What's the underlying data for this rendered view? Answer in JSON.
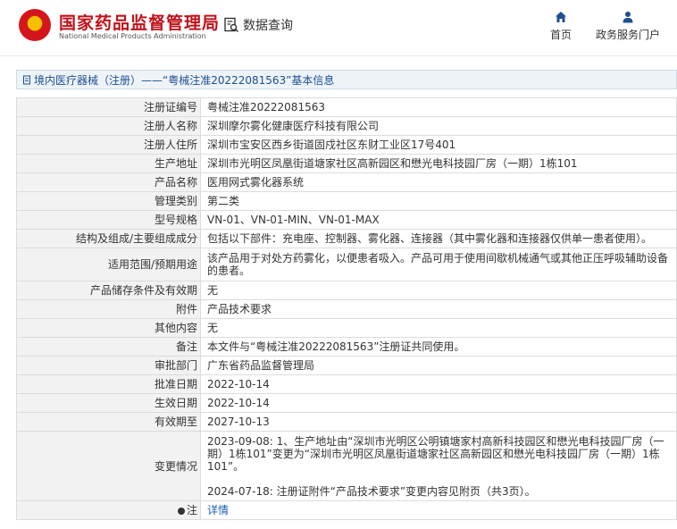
{
  "header": {
    "brand_cn": "国家药品监督管理局",
    "brand_en": "National Medical Products Administration",
    "query_label": "数据查询",
    "nav": [
      {
        "label": "首页",
        "icon": "home-icon"
      },
      {
        "label": "政务服务门户",
        "icon": "user-icon"
      }
    ]
  },
  "breadcrumb": "境内医疗器械（注册）——“粤械注准20222081563”基本信息",
  "rows": [
    {
      "label": "注册证编号",
      "value": "粤械注准20222081563"
    },
    {
      "label": "注册人名称",
      "value": "深圳摩尔雾化健康医疗科技有限公司"
    },
    {
      "label": "注册人住所",
      "value": "深圳市宝安区西乡街道固戍社区东财工业区17号401"
    },
    {
      "label": "生产地址",
      "value": "深圳市光明区凤凰街道塘家社区高新园区和懋光电科技园厂房（一期）1栋101"
    },
    {
      "label": "产品名称",
      "value": "医用网式雾化器系统"
    },
    {
      "label": "管理类别",
      "value": "第二类"
    },
    {
      "label": "型号规格",
      "value": "VN-01、VN-01-MIN、VN-01-MAX"
    },
    {
      "label": "结构及组成/主要组成成分",
      "value": "包括以下部件：充电座、控制器、雾化器、连接器（其中雾化器和连接器仅供单一患者使用）。"
    },
    {
      "label": "适用范围/预期用途",
      "value": "该产品用于对处方药雾化，以便患者吸入。产品可用于使用间歇机械通气或其他正压呼吸辅助设备的患者。"
    },
    {
      "label": "产品储存条件及有效期",
      "value": "无"
    },
    {
      "label": "附件",
      "value": "产品技术要求"
    },
    {
      "label": "其他内容",
      "value": "无"
    },
    {
      "label": "备注",
      "value": "本文件与“粤械注准20222081563”注册证共同使用。"
    },
    {
      "label": "审批部门",
      "value": "广东省药品监督管理局"
    },
    {
      "label": "批准日期",
      "value": "2022-10-14"
    },
    {
      "label": "生效日期",
      "value": "2022-10-14"
    },
    {
      "label": "有效期至",
      "value": "2027-10-13"
    }
  ],
  "change": {
    "label": "变更情况",
    "line1": "2023-09-08: 1、生产地址由“深圳市光明区公明镇塘家村高新科技园区和懋光电科技园厂房（一期）1栋101”变更为“深圳市光明区凤凰街道塘家社区高新园区和懋光电科技园厂房（一期）1栋101”。",
    "line2": "2024-07-18: 注册证附件“产品技术要求”变更内容见附页（共3页）。"
  },
  "note": {
    "label": "注",
    "link": "详情"
  }
}
